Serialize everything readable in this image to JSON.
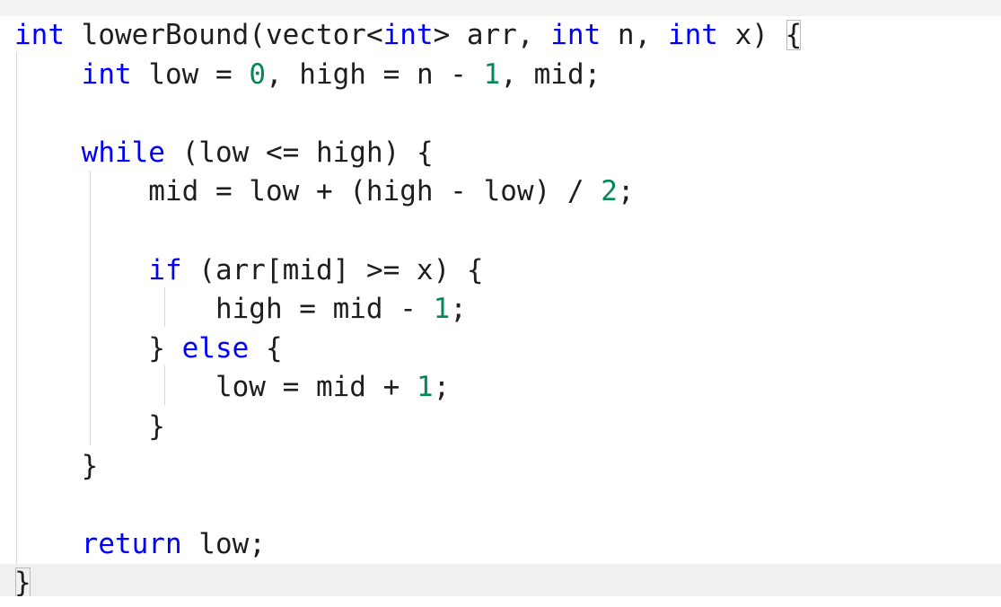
{
  "editor": {
    "lines": [
      [
        {
          "t": "int",
          "c": "kw"
        },
        {
          "t": " lowerBound(vector<",
          "c": ""
        },
        {
          "t": "int",
          "c": "kw"
        },
        {
          "t": "> arr, ",
          "c": ""
        },
        {
          "t": "int",
          "c": "kw"
        },
        {
          "t": " n, ",
          "c": ""
        },
        {
          "t": "int",
          "c": "kw"
        },
        {
          "t": " x) ",
          "c": ""
        },
        {
          "t": "{",
          "c": "brace-match"
        }
      ],
      [
        {
          "t": "    ",
          "c": ""
        },
        {
          "t": "int",
          "c": "kw"
        },
        {
          "t": " low = ",
          "c": ""
        },
        {
          "t": "0",
          "c": "num"
        },
        {
          "t": ", high = n - ",
          "c": ""
        },
        {
          "t": "1",
          "c": "num"
        },
        {
          "t": ", mid;",
          "c": ""
        }
      ],
      [],
      [
        {
          "t": "    ",
          "c": ""
        },
        {
          "t": "while",
          "c": "kw"
        },
        {
          "t": " (low <= high) {",
          "c": ""
        }
      ],
      [
        {
          "t": "        mid = low + (high - low) / ",
          "c": ""
        },
        {
          "t": "2",
          "c": "num"
        },
        {
          "t": ";",
          "c": ""
        }
      ],
      [],
      [
        {
          "t": "        ",
          "c": ""
        },
        {
          "t": "if",
          "c": "kw"
        },
        {
          "t": " (arr[mid] >= x) {",
          "c": ""
        }
      ],
      [
        {
          "t": "            high = mid - ",
          "c": ""
        },
        {
          "t": "1",
          "c": "num"
        },
        {
          "t": ";",
          "c": ""
        }
      ],
      [
        {
          "t": "        } ",
          "c": ""
        },
        {
          "t": "else",
          "c": "kw"
        },
        {
          "t": " {",
          "c": ""
        }
      ],
      [
        {
          "t": "            low = mid + ",
          "c": ""
        },
        {
          "t": "1",
          "c": "num"
        },
        {
          "t": ";",
          "c": ""
        }
      ],
      [
        {
          "t": "        }",
          "c": ""
        }
      ],
      [
        {
          "t": "    }",
          "c": ""
        }
      ],
      [],
      [
        {
          "t": "    ",
          "c": ""
        },
        {
          "t": "return",
          "c": "kw"
        },
        {
          "t": " low;",
          "c": ""
        }
      ],
      [
        {
          "t": "}",
          "c": "brace-match"
        }
      ]
    ]
  }
}
